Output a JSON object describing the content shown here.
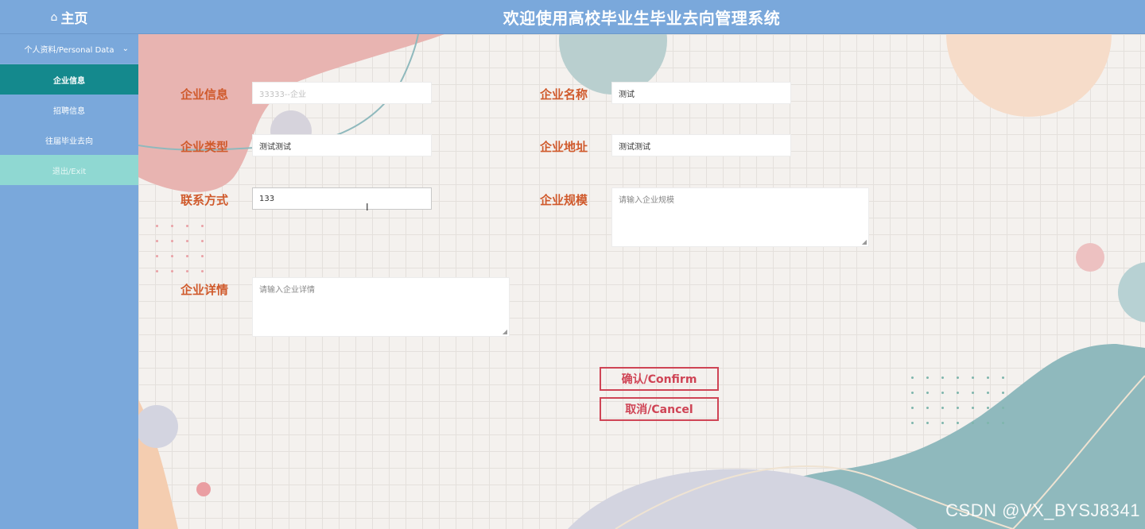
{
  "header": {
    "home_label": "主页",
    "home_icon": "home-icon",
    "title": "欢迎使用高校毕业生毕业去向管理系统"
  },
  "sidebar": {
    "group_label": "个人资料/Personal Data",
    "items": [
      {
        "label": "企业信息",
        "active": true
      },
      {
        "label": "招聘信息",
        "active": false
      },
      {
        "label": "往届毕业去向",
        "active": false
      },
      {
        "label": "退出/Exit",
        "active": false
      }
    ]
  },
  "form": {
    "company_account": {
      "label": "企业信息",
      "value": "33333--企业"
    },
    "company_name": {
      "label": "企业名称",
      "value": "测试"
    },
    "company_type": {
      "label": "企业类型",
      "value": "测试测试"
    },
    "company_address": {
      "label": "企业地址",
      "value": "测试测试"
    },
    "contact": {
      "label": "联系方式",
      "value": "133"
    },
    "company_scale": {
      "label": "企业规模",
      "placeholder": "请输入企业规模"
    },
    "company_details": {
      "label": "企业详情",
      "placeholder": "请输入企业详情"
    },
    "confirm_label": "确认/Confirm",
    "cancel_label": "取消/Cancel"
  },
  "watermark": "CSDN @VX_BYSJ8341",
  "colors": {
    "nav_bg": "#7aa8db",
    "active_item": "#14898d",
    "exit_item": "#8fd8d2",
    "label_orange": "#d05a2c",
    "button_red": "#cf4455"
  }
}
